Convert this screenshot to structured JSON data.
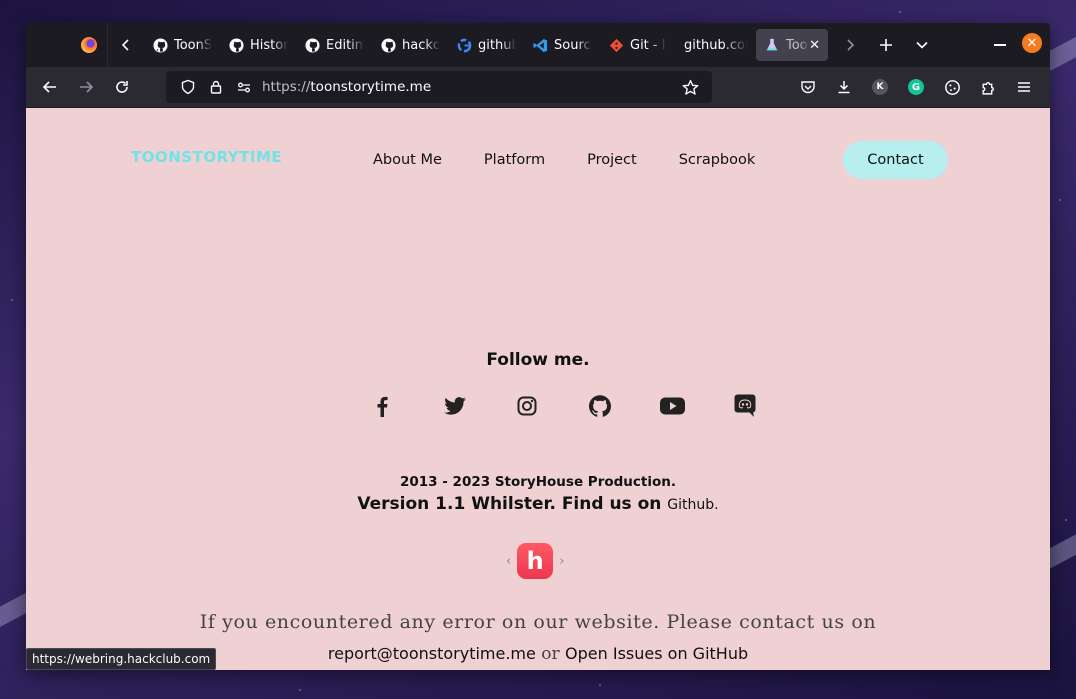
{
  "browser": {
    "tabs": [
      {
        "label": "ToonStoryTime",
        "icon": "github-icon"
      },
      {
        "label": "History",
        "icon": "github-icon"
      },
      {
        "label": "Editing",
        "icon": "github-icon"
      },
      {
        "label": "hackclub",
        "icon": "github-icon"
      },
      {
        "label": "github",
        "icon": "google-icon"
      },
      {
        "label": "Source",
        "icon": "vscode-icon"
      },
      {
        "label": "Git - I",
        "icon": "git-icon"
      },
      {
        "label": "github.com",
        "icon": "none"
      },
      {
        "label": "ToonStoryTime",
        "icon": "flask-icon",
        "active": true
      }
    ],
    "url_proto": "https://",
    "url_host": "toonstorytime.me",
    "status_tooltip": "https://webring.hackclub.com",
    "extension_k_label": "K",
    "extension_g_label": "G"
  },
  "site": {
    "logo": "TOONSTORYTIME",
    "nav": [
      "About Me",
      "Platform",
      "Project",
      "Scrapbook"
    ],
    "contact_label": "Contact",
    "follow_title": "Follow me.",
    "socials": [
      "facebook-icon",
      "twitter-icon",
      "instagram-icon",
      "github-icon",
      "youtube-icon",
      "discord-icon"
    ],
    "copyright": "2013 - 2023 StoryHouse Production.",
    "version_text": "Version 1.1 Whilster. Find us on ",
    "version_link": "Github",
    "webring_prev": "‹",
    "webring_next": "›",
    "webring_logo": "h",
    "error_line": "If you encountered any error on our website. Please contact us on",
    "error_email": "report@toonstorytime.me",
    "error_or": " or ",
    "error_issues": "Open Issues on GitHub"
  },
  "colors": {
    "page_bg": "#efd1d4",
    "logo": "#71e3e6",
    "contact_bg": "#b7eeee",
    "hackclub_red": "#ec3750",
    "window_close": "#f57d20"
  }
}
